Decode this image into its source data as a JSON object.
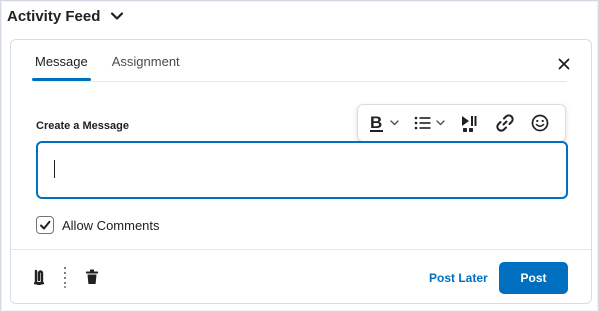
{
  "header": {
    "title": "Activity Feed",
    "toggle_icon": "chevron-down-icon"
  },
  "tabs": [
    {
      "label": "Message",
      "active": true
    },
    {
      "label": "Assignment",
      "active": false
    }
  ],
  "composer": {
    "label": "Create a Message",
    "input_value": "",
    "toolbar": [
      "bold-icon",
      "list-icon",
      "media-icon",
      "link-icon",
      "emoji-icon"
    ]
  },
  "options": {
    "allow_comments_label": "Allow Comments",
    "allow_comments_checked": true
  },
  "footer": {
    "attach_icon": "paperclip-icon",
    "more_icon": "vertical-dots-icon",
    "delete_icon": "trash-icon",
    "post_later_label": "Post Later",
    "post_label": "Post"
  },
  "colors": {
    "accent": "#006fbf",
    "text": "#202122",
    "border": "#d8dde4"
  }
}
